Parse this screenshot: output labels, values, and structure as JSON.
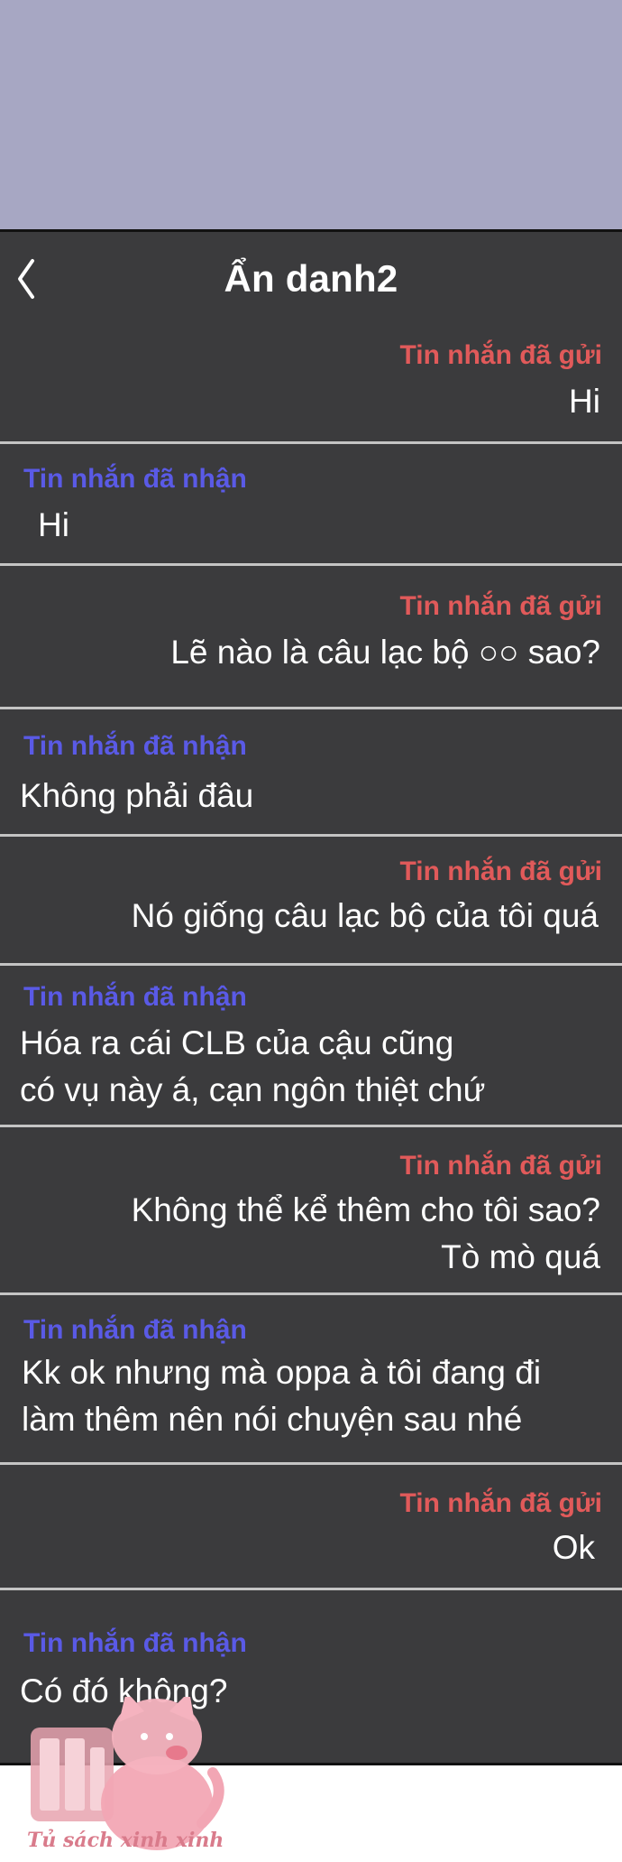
{
  "header": {
    "title": "Ẩn danh2"
  },
  "labels": {
    "sent": "Tin nhắn đã gửi",
    "received": "Tin nhắn đã nhận"
  },
  "messages": [
    {
      "direction": "sent",
      "label": "Tin nhắn đã gửi",
      "lines": [
        "Hi"
      ]
    },
    {
      "direction": "received",
      "label": "Tin nhắn đã nhận",
      "lines": [
        "Hi"
      ]
    },
    {
      "direction": "sent",
      "label": "Tin nhắn đã gửi",
      "lines": [
        "Lẽ nào là câu lạc bộ ○○ sao?"
      ]
    },
    {
      "direction": "received",
      "label": "Tin nhắn đã nhận",
      "lines": [
        "Không phải đâu"
      ]
    },
    {
      "direction": "sent",
      "label": "Tin nhắn đã gửi",
      "lines": [
        "Nó giống câu lạc bộ của tôi quá"
      ]
    },
    {
      "direction": "received",
      "label": "Tin nhắn đã nhận",
      "lines": [
        "Hóa ra cái CLB của cậu cũng",
        "có vụ này á, cạn ngôn thiệt chứ"
      ]
    },
    {
      "direction": "sent",
      "label": "Tin nhắn đã gửi",
      "lines": [
        "Không thể kể thêm cho tôi sao?",
        "Tò mò quá"
      ]
    },
    {
      "direction": "received",
      "label": "Tin nhắn đã nhận",
      "lines": [
        "Kk ok nhưng mà oppa à tôi đang đi",
        "làm thêm nên nói chuyện sau nhé"
      ]
    },
    {
      "direction": "sent",
      "label": "Tin nhắn đã gửi",
      "lines": [
        "Ok"
      ]
    },
    {
      "direction": "received",
      "label": "Tin nhắn đã nhận",
      "lines": [
        "Có đó không?"
      ]
    }
  ],
  "colors": {
    "background_top": "#a7a7c3",
    "chat_background": "#3b3b3d",
    "sent_label": "#e15a5a",
    "received_label": "#5a5ae6",
    "message_text": "#ffffff",
    "divider": "#c4c4c4"
  },
  "icons": {
    "back": "chevron-left-icon",
    "watermark": "cat-bookshelf-logo"
  },
  "watermark": {
    "text": "Tủ sách xinh xinh"
  }
}
